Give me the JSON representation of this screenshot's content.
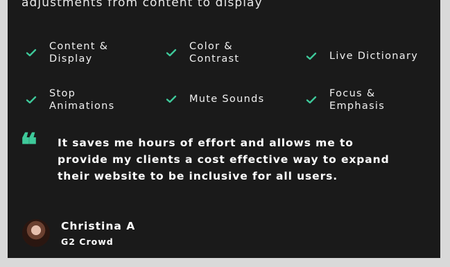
{
  "intro": {
    "text": "adjustments from content to display"
  },
  "features": [
    {
      "label": "Content &\nDisplay"
    },
    {
      "label": "Color &\nContrast"
    },
    {
      "label": "Live Dictionary"
    },
    {
      "label": "Stop\nAnimations"
    },
    {
      "label": "Mute Sounds"
    },
    {
      "label": "Focus &\nEmphasis"
    }
  ],
  "testimonial": {
    "quote_icon": "quote-icon",
    "text": "It saves me hours of effort and allows me to provide my clients a cost effective way to expand their website to be inclusive for all users.",
    "author": "Christina A",
    "source": "G2 Crowd"
  },
  "colors": {
    "accent": "#3ec99a",
    "panel": "#1a1a1a",
    "page": "#d9d9d9"
  },
  "icons": {
    "check": "check-icon"
  }
}
